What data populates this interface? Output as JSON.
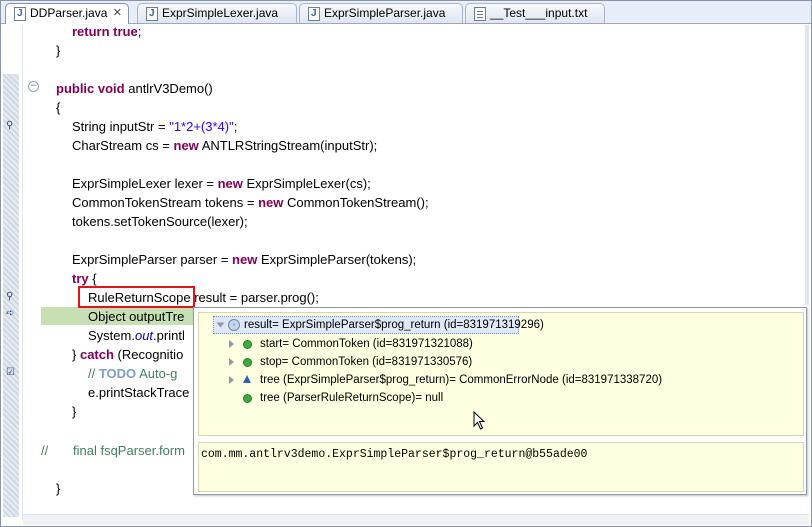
{
  "tabs": [
    {
      "label": "DDParser.java",
      "icon": "java-file-icon",
      "active": true,
      "closable": true
    },
    {
      "label": "ExprSimpleLexer.java",
      "icon": "java-file-icon",
      "active": false
    },
    {
      "label": "ExprSimpleParser.java",
      "icon": "java-file-icon",
      "active": false
    },
    {
      "label": "__Test___input.txt",
      "icon": "text-file-icon",
      "active": false
    }
  ],
  "code": {
    "l1_kw": "return true",
    "l1_end": ";",
    "l2": "}",
    "l3_kw": "public void",
    "l3_rest": " antlrV3Demo()",
    "l4": "{",
    "l5_a": "String inputStr = ",
    "l5_str": "\"1*2+(3*4)\"",
    "l5_end": ";",
    "l6_a": "CharStream cs = ",
    "l6_kw": "new",
    "l6_b": " ANTLRStringStream(inputStr);",
    "l7_a": "ExprSimpleLexer lexer = ",
    "l7_kw": "new",
    "l7_b": " ExprSimpleLexer(cs);",
    "l8_a": "CommonTokenStream tokens = ",
    "l8_kw": "new",
    "l8_b": " CommonTokenStream();",
    "l9": "tokens.setTokenSource(lexer);",
    "l10_a": "ExprSimpleParser parser = ",
    "l10_kw": "new",
    "l10_b": " ExprSimpleParser(tokens);",
    "l11_kw": "try",
    "l11_b": " {",
    "l12": "RuleReturnScope result = parser.prog();",
    "l13": "Object outputTre",
    "l14_a": "System.",
    "l14_it": "out",
    "l14_b": ".printl",
    "l15_a": "} ",
    "l15_kw": "catch",
    "l15_b": " (Recognitio",
    "l16_a": "// ",
    "l16_todo": "TODO",
    "l16_b": " Auto-g",
    "l17": "e.printStackTrace",
    "l18": "}",
    "l19_a": "//",
    "l19_b": "final fsqParser.form",
    "l20": "}"
  },
  "popup": {
    "root": "result= ExprSimpleParser$prog_return  (id=831971319296)",
    "children": [
      {
        "label": "start= CommonToken  (id=831971321088)",
        "icon": "green-dot",
        "expandable": true
      },
      {
        "label": "stop= CommonToken  (id=831971330576)",
        "icon": "green-dot",
        "expandable": true
      },
      {
        "label": "tree (ExprSimpleParser$prog_return)= CommonErrorNode  (id=831971338720)",
        "icon": "blue-triangle",
        "expandable": true
      },
      {
        "label": "tree (ParserRuleReturnScope)= null",
        "icon": "green-dot",
        "expandable": false
      }
    ],
    "detail": "com.mm.antlrv3demo.ExprSimpleParser$prog_return@b55ade00"
  }
}
